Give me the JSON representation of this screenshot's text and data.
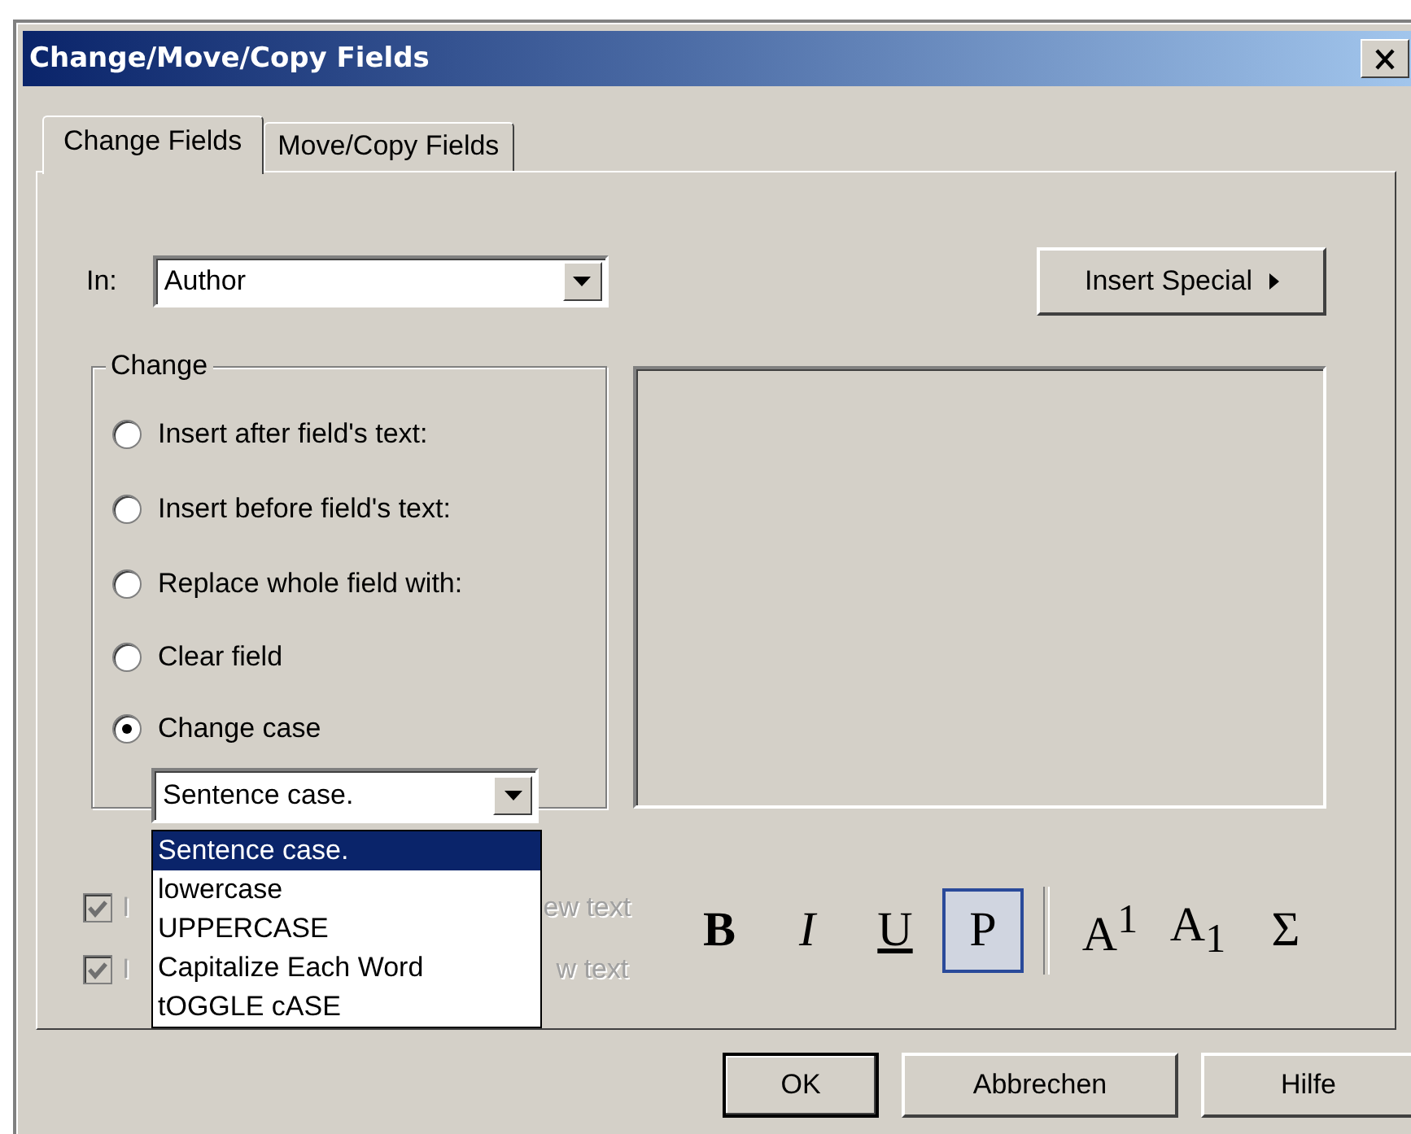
{
  "window": {
    "title": "Change/Move/Copy Fields"
  },
  "tabs": [
    {
      "label": "Change Fields",
      "selected": true
    },
    {
      "label": "Move/Copy Fields",
      "selected": false
    }
  ],
  "in_field": {
    "label": "In:",
    "value": "Author"
  },
  "insert_special": {
    "label": "Insert Special"
  },
  "change_group": {
    "title": "Change",
    "options": [
      {
        "label": "Insert after field's text:",
        "selected": false
      },
      {
        "label": "Insert before field's text:",
        "selected": false
      },
      {
        "label": "Replace whole field with:",
        "selected": false
      },
      {
        "label": "Clear field",
        "selected": false
      },
      {
        "label": "Change case",
        "selected": true
      }
    ],
    "case_combo": {
      "value": "Sentence case.",
      "expanded": true,
      "options": [
        {
          "label": "Sentence case.",
          "selected": true
        },
        {
          "label": "lowercase",
          "selected": false
        },
        {
          "label": "UPPERCASE",
          "selected": false
        },
        {
          "label": "Capitalize Each Word",
          "selected": false
        },
        {
          "label": "tOGGLE cASE",
          "selected": false
        }
      ]
    }
  },
  "checkboxes": [
    {
      "text_before": "I",
      "text_after": "ew text",
      "checked": true,
      "disabled": true
    },
    {
      "text_before": "I",
      "text_after": "w text",
      "checked": true,
      "disabled": true
    }
  ],
  "format_buttons": [
    {
      "label": "B",
      "kind": "bold",
      "selected": false
    },
    {
      "label": "I",
      "kind": "italic",
      "selected": false
    },
    {
      "label": "U",
      "kind": "underline",
      "selected": false
    },
    {
      "label": "P",
      "kind": "plain",
      "selected": true
    },
    {
      "label": "A$^{1}$",
      "kind": "superscript",
      "selected": false
    },
    {
      "label": "A$_{1}$",
      "kind": "subscript",
      "selected": false
    },
    {
      "label": "Σ",
      "kind": "symbol",
      "selected": false
    }
  ],
  "buttons": [
    {
      "label": "OK",
      "default": true
    },
    {
      "label": "Abbrechen",
      "default": false
    },
    {
      "label": "Hilfe",
      "default": false
    }
  ]
}
